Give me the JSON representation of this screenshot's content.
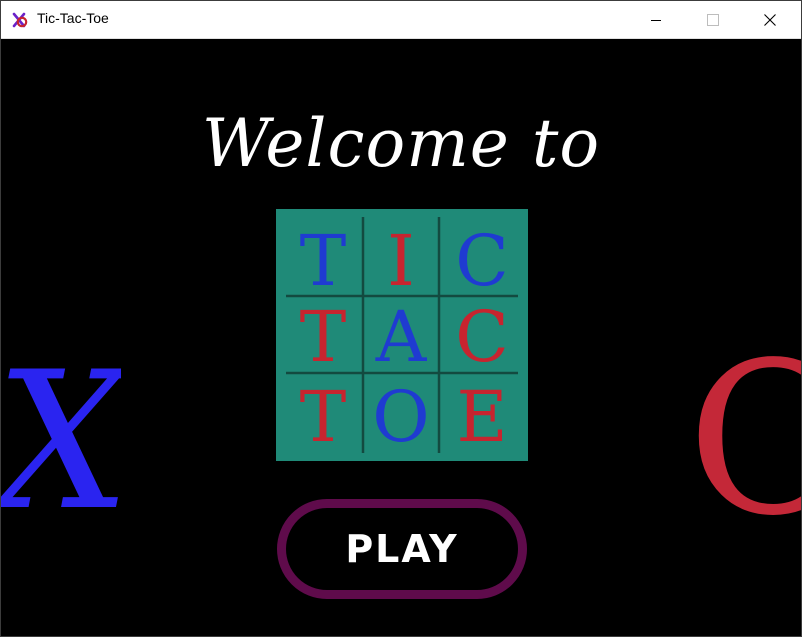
{
  "window": {
    "title": "Tic-Tac-Toe"
  },
  "screen": {
    "welcome_text": "Welcome to",
    "play_label": "PLAY"
  },
  "logo": {
    "cells": [
      {
        "letter": "T",
        "color": "#1f3bd1"
      },
      {
        "letter": "I",
        "color": "#c7242f"
      },
      {
        "letter": "C",
        "color": "#1f3bd1"
      },
      {
        "letter": "T",
        "color": "#c7242f"
      },
      {
        "letter": "A",
        "color": "#1f3bd1"
      },
      {
        "letter": "C",
        "color": "#c7242f"
      },
      {
        "letter": "T",
        "color": "#c7242f"
      },
      {
        "letter": "O",
        "color": "#1f3bd1"
      },
      {
        "letter": "E",
        "color": "#c7242f"
      }
    ],
    "background": "#1f8a78",
    "grid_color": "#134a40"
  },
  "decorations": {
    "left_mark": "X",
    "left_color": "#2a24f0",
    "right_mark": "O",
    "right_color": "#c42838"
  },
  "colors": {
    "background": "#000000",
    "play_border": "#5f0b4b"
  },
  "icons": {
    "app": "tic-tac-toe-app-icon",
    "minimize": "minimize-icon",
    "maximize": "maximize-icon",
    "close": "close-icon"
  }
}
